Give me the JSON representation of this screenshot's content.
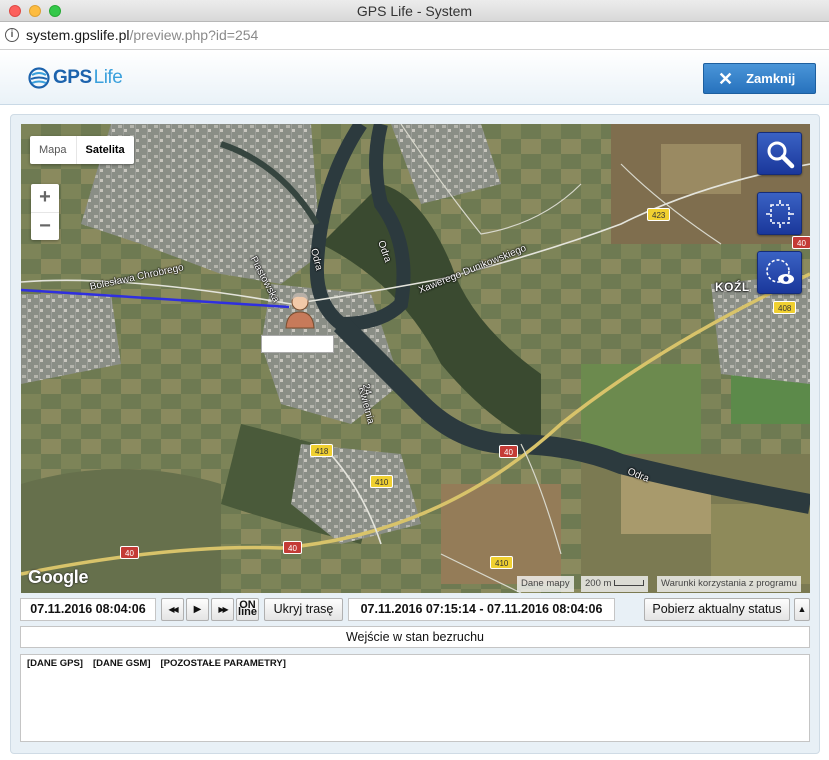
{
  "window": {
    "title": "GPS Life - System"
  },
  "browser": {
    "url_host": "system.gpslife.pl",
    "url_path": "/preview.php?id=254"
  },
  "header": {
    "logo_gps": "GPS",
    "logo_life": "Life",
    "close_label": "Zamknij"
  },
  "map": {
    "types": [
      "Mapa",
      "Satelita"
    ],
    "active_type": "Satelita",
    "zoom_in": "+",
    "zoom_out": "−",
    "street_labels": [
      "Bolesława Chrobrego",
      "Piastowska",
      "Odra",
      "Odra",
      "Kwietnia",
      "24",
      "Xawerego Dunikowskiego",
      "Odra",
      "KOŹL"
    ],
    "road_numbers": [
      "40",
      "40",
      "40",
      "40",
      "408",
      "410",
      "410",
      "418",
      "423"
    ],
    "google": "Google",
    "attribution": {
      "data": "Dane mapy",
      "scale": "200 m",
      "terms": "Warunki korzystania z programu"
    },
    "tools": [
      "search-icon",
      "select-area-icon",
      "view-area-icon"
    ]
  },
  "controls": {
    "current_time": "07.11.2016 08:04:06",
    "rewind": "◀◀",
    "play": "▶",
    "forward": "▶▶",
    "on_top": "ON",
    "on_bottom": "line",
    "hide_route": "Ukryj trasę",
    "time_range": "07.11.2016 07:15:14 - 07.11.2016 08:04:06",
    "fetch_status": "Pobierz aktualny status",
    "collapse": "▲"
  },
  "status": {
    "message": "Wejście w stan bezruchu"
  },
  "info": {
    "tabs": [
      "[DANE GPS]",
      "[DANE GSM]",
      "[POZOSTAŁE PARAMETRY]"
    ]
  },
  "colors": {
    "accent": "#2772bd",
    "route": "#2f2fe0",
    "map_tool": "#1a379b"
  }
}
